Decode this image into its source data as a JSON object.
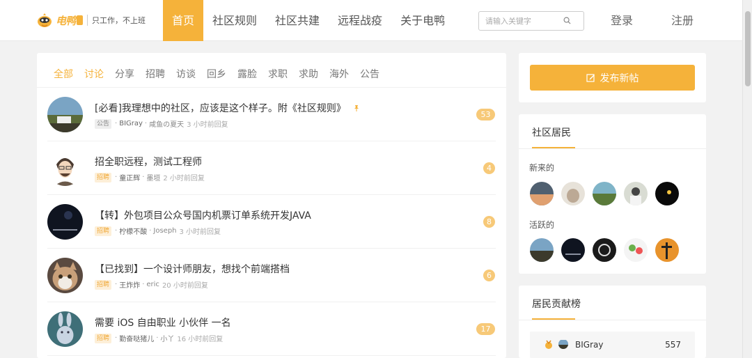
{
  "header": {
    "logo_text": "电鸭",
    "slogan": "只工作，不上班",
    "nav": [
      {
        "label": "首页",
        "active": true
      },
      {
        "label": "社区规则",
        "active": false
      },
      {
        "label": "社区共建",
        "active": false
      },
      {
        "label": "远程战疫",
        "active": false
      },
      {
        "label": "关于电鸭",
        "active": false
      }
    ],
    "search_placeholder": "请输入关键字",
    "login": "登录",
    "register": "注册"
  },
  "tabs": [
    {
      "label": "全部",
      "active": true
    },
    {
      "label": "讨论",
      "active": true
    },
    {
      "label": "分享"
    },
    {
      "label": "招聘"
    },
    {
      "label": "访谈"
    },
    {
      "label": "回乡"
    },
    {
      "label": "露脸"
    },
    {
      "label": "求职"
    },
    {
      "label": "求助"
    },
    {
      "label": "海外"
    },
    {
      "label": "公告"
    }
  ],
  "posts": [
    {
      "title": "[必看]我理想中的社区，应该是这个样子。附《社区规则》",
      "pinned": true,
      "tag": "公告",
      "author": "BIGray",
      "replier": "咸鱼の夏天",
      "time": "3 小时前回复",
      "count": "53"
    },
    {
      "title": "招全职远程，测试工程师",
      "pinned": false,
      "tag": "招聘",
      "author": "童正辉",
      "replier": "墨垣",
      "time": "2 小时前回复",
      "count": "4"
    },
    {
      "title": "【转】外包项目公众号国内机票订单系统开发JAVA",
      "pinned": false,
      "tag": "招聘",
      "author": "柠檬不酸",
      "replier": "Joseph",
      "time": "3 小时前回复",
      "count": "8"
    },
    {
      "title": "【已找到】一个设计师朋友，想找个前端搭档",
      "pinned": false,
      "tag": "招聘",
      "author": "王炸炸",
      "replier": "eric",
      "time": "20 小时前回复",
      "count": "6"
    },
    {
      "title": "需要 iOS 自由职业 小伙伴 一名",
      "pinned": false,
      "tag": "招聘",
      "author": "勤奋哒猪儿",
      "replier": "小丫",
      "time": "16 小时前回复",
      "count": "17"
    }
  ],
  "sidebar": {
    "publish_label": "发布新帖",
    "residents_title": "社区居民",
    "new_label": "新来的",
    "active_label": "活跃的",
    "ranking_title": "居民贡献榜",
    "ranking": [
      {
        "name": "BIGray",
        "score": "557"
      }
    ]
  },
  "colors": {
    "accent": "#f5b23a",
    "badge": "#f7c978"
  }
}
